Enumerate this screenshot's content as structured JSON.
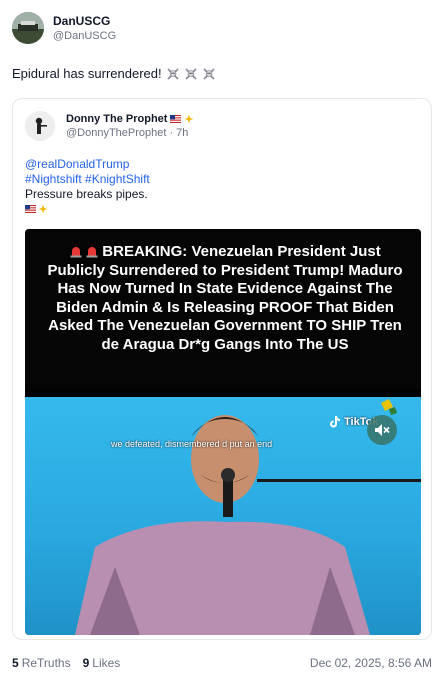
{
  "post": {
    "author": {
      "display_name": "DanUSCG",
      "handle": "@DanUSCG"
    },
    "text": "Epidural has surrendered!",
    "trailing_icons": [
      "skull-crossbones-icon",
      "skull-crossbones-icon",
      "skull-crossbones-icon"
    ]
  },
  "quote": {
    "author": {
      "display_name": "Donny The Prophet",
      "handle": "@DonnyTheProphet",
      "separator": "·",
      "time": "7h"
    },
    "name_icons": [
      "us-flag-icon",
      "dizzy-sparkle-icon"
    ],
    "lines": [
      "@realDonaldTrump",
      "#Nightshift #KnightShift",
      "Pressure breaks pipes."
    ],
    "media": {
      "headline": "BREAKING: Venezuelan President Just Publicly Surrendered to President Trump! Maduro Has Now Turned In State Evidence Against The Biden Admin & Is Releasing PROOF That Biden Asked The Venezuelan Government TO SHIP Tren de Aragua Dr*g Gangs Into The US",
      "subtitle": "we defeated, dismembered  d put an end",
      "watermark": "TikTok",
      "mute_icon": "speaker-muted-icon",
      "colors": {
        "sky": "#35b9ec",
        "headline_bg": "#050505"
      }
    }
  },
  "footer": {
    "retruths_count": "5",
    "retruths_label": "ReTruths",
    "likes_count": "9",
    "likes_label": "Likes",
    "date": "Dec 02, 2025, 8:56 AM"
  }
}
